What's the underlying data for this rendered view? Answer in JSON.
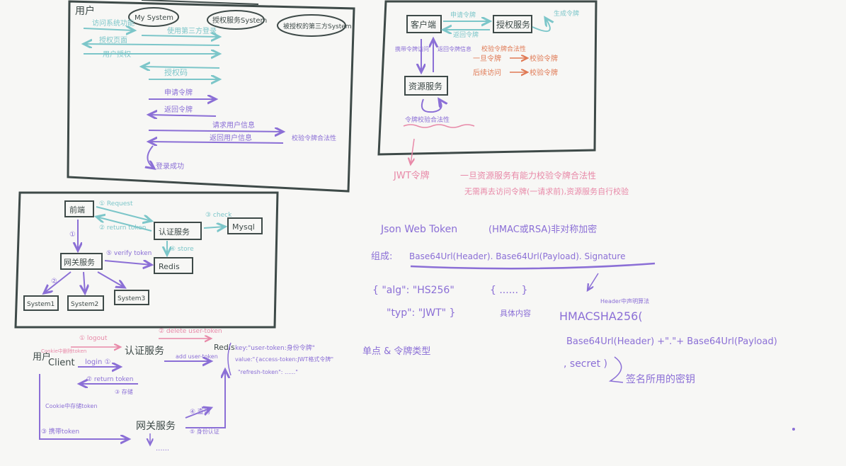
{
  "colors": {
    "ink": "#3e4a48",
    "teal": "#7cc6c9",
    "purple": "#8b6fd6",
    "pink": "#e889a8",
    "orange": "#e07a55"
  },
  "panel1": {
    "user": "用户",
    "my_system": "My System",
    "auth_service": "授权服务System",
    "third_party": "被授权的第三方System",
    "m1": "访问系统功能",
    "m2": "使用第三方登录",
    "m3": "授权页面",
    "m4": "用户授权",
    "m5": "授权码",
    "m6": "申请令牌",
    "m7": "返回令牌",
    "m8": "请求用户信息",
    "m9": "返回用户信息",
    "m10": "校验令牌合法性",
    "m11": "登录成功"
  },
  "panel2": {
    "client": "客户端",
    "auth": "授权服务",
    "resource": "资源服务",
    "r1": "申请令牌",
    "r2": "返回令牌",
    "r3": "生成令牌",
    "r4": "携带令牌访问",
    "r5": "令牌校验合法性",
    "r6": "校验令牌合法性",
    "o1": "返回令牌信息",
    "o2": "一旦令牌",
    "o3": "校验令牌",
    "o4": "后续访问",
    "o5": "校验令牌"
  },
  "jwt": {
    "title": "JWT令牌",
    "desc1": "一旦资源服务有能力校验令牌合法性",
    "desc2": "无需再去访问令牌(一请求前),资源服务自行校验",
    "line1": "Json Web Token",
    "line1b": "(HMAC或RSA)非对称加密",
    "comp": "组成:",
    "parts": "Base64Url(Header). Base64Url(Payload). Signature",
    "header1": "{ \"alg\": \"HS256\"",
    "header2": "\"typ\": \"JWT\" }",
    "payload": "{ ...... }",
    "payload_label": "具体内容",
    "sig_note": "Header中声明算法",
    "hmac": "HMACSHA256(",
    "hmac2": "Base64Url(Header) +\".\"+ Base64Url(Payload)",
    "secret": ", secret )",
    "secret_note": "签名所用的密钥"
  },
  "panel3": {
    "frontend": "前端",
    "gateway": "网关服务",
    "auth": "认证服务",
    "mysql": "Mysql",
    "redis": "Redis",
    "s1": "System1",
    "s2": "System2",
    "s3": "System3",
    "e1": "① Request",
    "e2": "② return token",
    "e3": "③ check",
    "e4": "④ store",
    "e5": "⑤ verify token",
    "n1": "①",
    "n2": "②"
  },
  "panel4": {
    "client": "Client",
    "user": "用户",
    "auth": "认证服务",
    "redis": "Redis",
    "gateway": "网关服务",
    "logout": "① logout",
    "delete": "② delete user-token",
    "login": "login ①",
    "return": "② return token",
    "cookie1": "Cookie中删除token",
    "cookie2": "Cookie中存储token",
    "store": "③ 存储",
    "add": "add user-token",
    "key": "key:\"user-token:身份令牌\"",
    "value": "value:\"{access-token:JWT格式令牌\"",
    "refresh": "\"refresh-token\": ......\"",
    "types": "单点 & 令牌类型",
    "carry": "③ 携带token",
    "query": "④ 查询",
    "ret": "⑤ 身份认证",
    "dots": "......"
  }
}
